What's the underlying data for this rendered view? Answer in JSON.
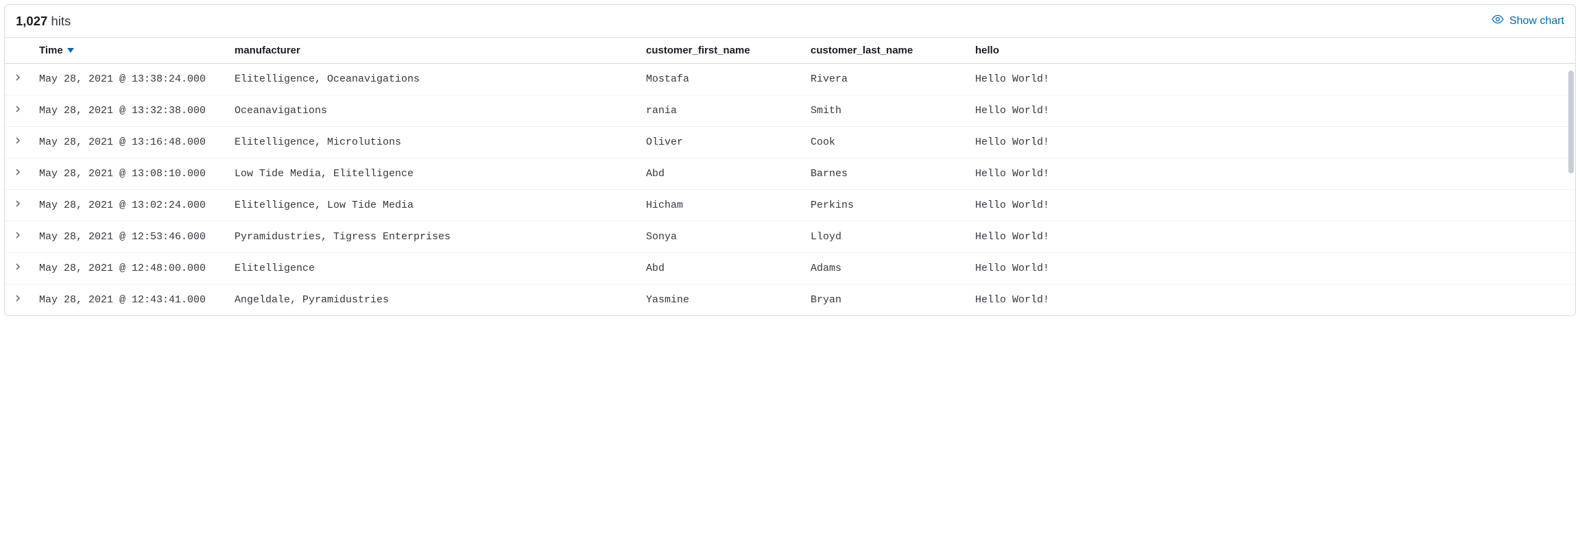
{
  "header": {
    "hits_count": "1,027",
    "hits_label": "hits",
    "show_chart_label": "Show chart"
  },
  "columns": {
    "time": "Time",
    "manufacturer": "manufacturer",
    "customer_first_name": "customer_first_name",
    "customer_last_name": "customer_last_name",
    "hello": "hello"
  },
  "rows": [
    {
      "time": "May 28, 2021 @ 13:38:24.000",
      "manufacturer": "Elitelligence, Oceanavigations",
      "first": "Mostafa",
      "last": "Rivera",
      "hello": "Hello World!"
    },
    {
      "time": "May 28, 2021 @ 13:32:38.000",
      "manufacturer": "Oceanavigations",
      "first": "rania",
      "last": "Smith",
      "hello": "Hello World!"
    },
    {
      "time": "May 28, 2021 @ 13:16:48.000",
      "manufacturer": "Elitelligence, Microlutions",
      "first": "Oliver",
      "last": "Cook",
      "hello": "Hello World!"
    },
    {
      "time": "May 28, 2021 @ 13:08:10.000",
      "manufacturer": "Low Tide Media, Elitelligence",
      "first": "Abd",
      "last": "Barnes",
      "hello": "Hello World!"
    },
    {
      "time": "May 28, 2021 @ 13:02:24.000",
      "manufacturer": "Elitelligence, Low Tide Media",
      "first": "Hicham",
      "last": "Perkins",
      "hello": "Hello World!"
    },
    {
      "time": "May 28, 2021 @ 12:53:46.000",
      "manufacturer": "Pyramidustries, Tigress Enterprises",
      "first": "Sonya",
      "last": "Lloyd",
      "hello": "Hello World!"
    },
    {
      "time": "May 28, 2021 @ 12:48:00.000",
      "manufacturer": "Elitelligence",
      "first": "Abd",
      "last": "Adams",
      "hello": "Hello World!"
    },
    {
      "time": "May 28, 2021 @ 12:43:41.000",
      "manufacturer": "Angeldale, Pyramidustries",
      "first": "Yasmine",
      "last": "Bryan",
      "hello": "Hello World!"
    }
  ]
}
